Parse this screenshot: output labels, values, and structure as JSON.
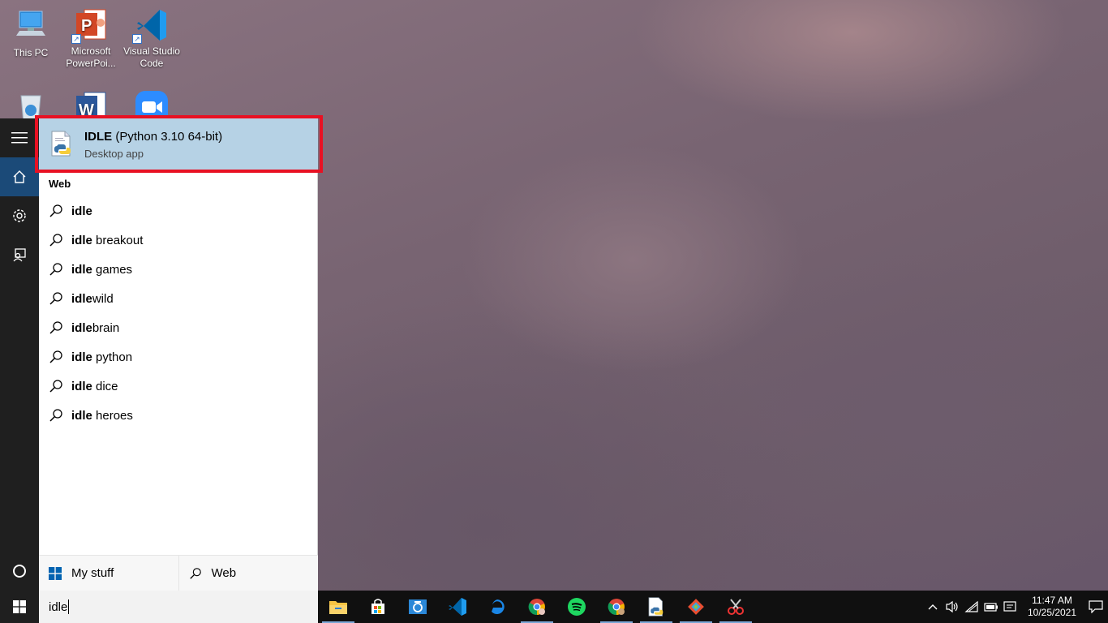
{
  "desktop": {
    "icons": [
      {
        "label": "This PC",
        "icon": "this-pc-icon"
      },
      {
        "label": "Microsoft PowerPoi...",
        "icon": "powerpoint-icon"
      },
      {
        "label": "Visual Studio Code",
        "icon": "vscode-icon"
      },
      {
        "label": "",
        "icon": "recycle-bin-icon"
      },
      {
        "label": "",
        "icon": "word-icon"
      },
      {
        "label": "",
        "icon": "zoom-icon"
      }
    ]
  },
  "sidebar": {
    "items": [
      {
        "name": "hamburger-menu",
        "icon": "hamburger-icon"
      },
      {
        "name": "home",
        "icon": "home-icon",
        "active": true
      },
      {
        "name": "settings",
        "icon": "gear-icon"
      },
      {
        "name": "feedback",
        "icon": "feedback-icon"
      }
    ],
    "bottom": [
      {
        "name": "cortana",
        "icon": "cortana-circle-icon"
      },
      {
        "name": "start",
        "icon": "windows-logo-icon"
      }
    ]
  },
  "search_panel": {
    "best_match": {
      "title_bold": "IDLE",
      "title_rest": " (Python 3.10 64-bit)",
      "subtitle": "Desktop app",
      "icon": "python-idle-icon",
      "highlight_color": "#e81123"
    },
    "web_section_label": "Web",
    "web_results": [
      {
        "bold": "idle",
        "rest": ""
      },
      {
        "bold": "idle",
        "rest": " breakout"
      },
      {
        "bold": "idle",
        "rest": " games"
      },
      {
        "bold": "idle",
        "rest": "wild"
      },
      {
        "bold": "idle",
        "rest": "brain"
      },
      {
        "bold": "idle",
        "rest": " python"
      },
      {
        "bold": "idle",
        "rest": " dice"
      },
      {
        "bold": "idle",
        "rest": " heroes"
      }
    ],
    "tabs": {
      "my_stuff": "My stuff",
      "web": "Web"
    }
  },
  "search_box": {
    "value": "idle"
  },
  "taskbar": {
    "apps": [
      {
        "name": "file-explorer",
        "icon": "file-explorer-icon",
        "running": true
      },
      {
        "name": "store",
        "icon": "store-icon",
        "running": false
      },
      {
        "name": "camera",
        "icon": "camera-icon",
        "running": false
      },
      {
        "name": "vscode",
        "icon": "vscode-icon",
        "running": false
      },
      {
        "name": "edge",
        "icon": "edge-icon",
        "running": false
      },
      {
        "name": "chrome-profile-1",
        "icon": "chrome-icon",
        "running": true
      },
      {
        "name": "spotify",
        "icon": "spotify-icon",
        "running": false
      },
      {
        "name": "chrome-profile-2",
        "icon": "chrome-icon",
        "running": true
      },
      {
        "name": "python-idle",
        "icon": "python-idle-icon",
        "running": true
      },
      {
        "name": "git",
        "icon": "git-icon",
        "running": true
      },
      {
        "name": "snipping-tool",
        "icon": "snipping-tool-icon",
        "running": true
      }
    ],
    "tray": {
      "time": "11:47 AM",
      "date": "10/25/2021"
    }
  },
  "colors": {
    "taskbar": "#101010",
    "sidebar": "#1f1f1f",
    "sidebar_active": "#1b4a78",
    "best_match_bg": "#b6d2e5"
  }
}
